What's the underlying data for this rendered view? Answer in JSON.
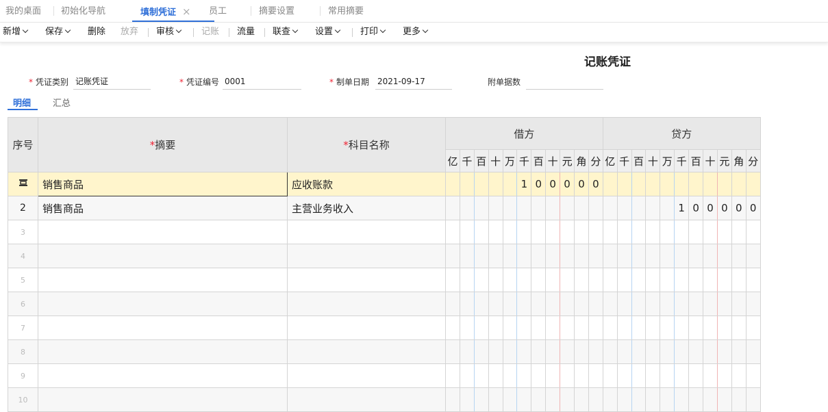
{
  "tabs": [
    {
      "label": "我的桌面"
    },
    {
      "label": "初始化导航"
    },
    {
      "label": "填制凭证",
      "active": true,
      "close": "×"
    },
    {
      "label": "员工"
    },
    {
      "label": "摘要设置"
    },
    {
      "label": "常用摘要"
    }
  ],
  "toolbar": {
    "add": "新增",
    "save": "保存",
    "delete": "删除",
    "discard": "放弃",
    "audit": "审核",
    "post": "记账",
    "flow": "流量",
    "link_query": "联查",
    "settings": "设置",
    "print": "打印",
    "more": "更多"
  },
  "voucher": {
    "title": "记账凭证",
    "type_label": "凭证类别",
    "type_value": "记账凭证",
    "number_label": "凭证编号",
    "number_value": "0001",
    "date_label": "制单日期",
    "date_value": "2021-09-17",
    "attachments_label": "附单据数",
    "attachments_value": ""
  },
  "subtabs": {
    "detail": "明细",
    "summary": "汇总"
  },
  "grid": {
    "headers": {
      "seq": "序号",
      "summary": "摘要",
      "account": "科目名称",
      "debit": "借方",
      "credit": "贷方"
    },
    "units": [
      "亿",
      "千",
      "百",
      "十",
      "万",
      "千",
      "百",
      "十",
      "元",
      "角",
      "分"
    ],
    "rows": [
      {
        "seq": "",
        "summary": "销售商品",
        "account": "应收账款",
        "debit": [
          "",
          "",
          "",
          "",
          "",
          "1",
          "0",
          "0",
          "0",
          "0",
          "0"
        ],
        "credit": [
          "",
          "",
          "",
          "",
          "",
          "",
          "",
          "",
          "",
          "",
          ""
        ]
      },
      {
        "seq": "2",
        "summary": "销售商品",
        "account": "主营业务收入",
        "debit": [
          "",
          "",
          "",
          "",
          "",
          "",
          "",
          "",
          "",
          "",
          ""
        ],
        "credit": [
          "",
          "",
          "",
          "",
          "",
          "1",
          "0",
          "0",
          "0",
          "0",
          "0"
        ]
      },
      {
        "seq": "3"
      },
      {
        "seq": "4"
      },
      {
        "seq": "5"
      },
      {
        "seq": "6"
      },
      {
        "seq": "7"
      },
      {
        "seq": "8"
      },
      {
        "seq": "9"
      },
      {
        "seq": "10"
      }
    ]
  }
}
